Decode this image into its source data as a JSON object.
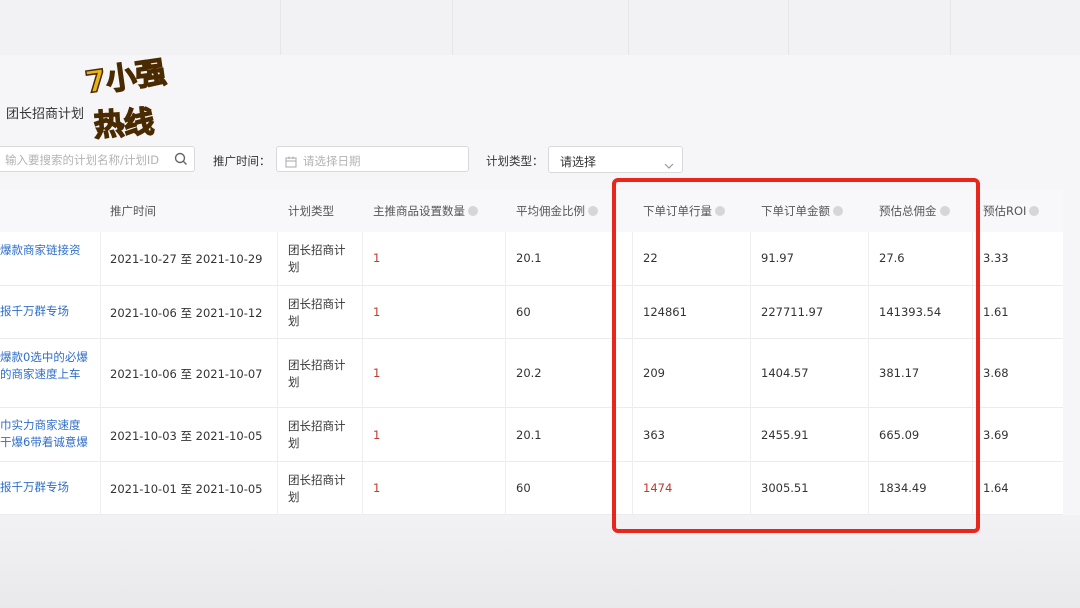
{
  "page_title": "团长招商计划",
  "logo_text": "小强热线",
  "search": {
    "placeholder": "输入要搜索的计划名称/计划ID"
  },
  "filters": {
    "promo_time_label": "推广时间：",
    "date_placeholder": "请选择日期",
    "plan_type_label": "计划类型：",
    "plan_type_value": "请选择"
  },
  "table": {
    "headers": {
      "promo_time": "推广时间",
      "plan_type": "计划类型",
      "product_count": "主推商品设置数量",
      "avg_commission": "平均佣金比例",
      "order_count": "下单订单行量",
      "order_amount": "下单订单金额",
      "est_commission": "预估总佣金",
      "est_roi": "预估ROI"
    },
    "rows": [
      {
        "name": [
          "爆款商家链接资"
        ],
        "period": "2021-10-27 至 2021-10-29",
        "type": [
          "团长招商计",
          "划"
        ],
        "count": "1",
        "avg": "20.1",
        "orders": "22",
        "amount": "91.97",
        "commission": "27.6",
        "roi": "3.33"
      },
      {
        "name": [
          "报千万群专场"
        ],
        "period": "2021-10-06 至 2021-10-12",
        "type": [
          "团长招商计",
          "划"
        ],
        "count": "1",
        "avg": "60",
        "orders": "124861",
        "amount": "227711.97",
        "commission": "141393.54",
        "roi": "1.61"
      },
      {
        "name": [
          "爆款0选中的必爆",
          "的商家速度上车"
        ],
        "period": "2021-10-06 至 2021-10-07",
        "type": [
          "团长招商计",
          "划"
        ],
        "count": "1",
        "avg": "20.2",
        "orders": "209",
        "amount": "1404.57",
        "commission": "381.17",
        "roi": "3.68"
      },
      {
        "name": [
          "巾实力商家速度",
          "干爆6带着诚意爆"
        ],
        "period": "2021-10-03 至 2021-10-05",
        "type": [
          "团长招商计",
          "划"
        ],
        "count": "1",
        "avg": "20.1",
        "orders": "363",
        "amount": "2455.91",
        "commission": "665.09",
        "roi": "3.69"
      },
      {
        "name": [
          "报千万群专场"
        ],
        "period": "2021-10-01 至 2021-10-05",
        "type": [
          "团长招商计",
          "划"
        ],
        "count": "1",
        "avg": "60",
        "orders": "1474",
        "amount": "3005.51",
        "commission": "1834.49",
        "roi": "1.64"
      }
    ]
  },
  "colors": {
    "highlight": "#e8261c",
    "link": "#2f6ec9"
  }
}
